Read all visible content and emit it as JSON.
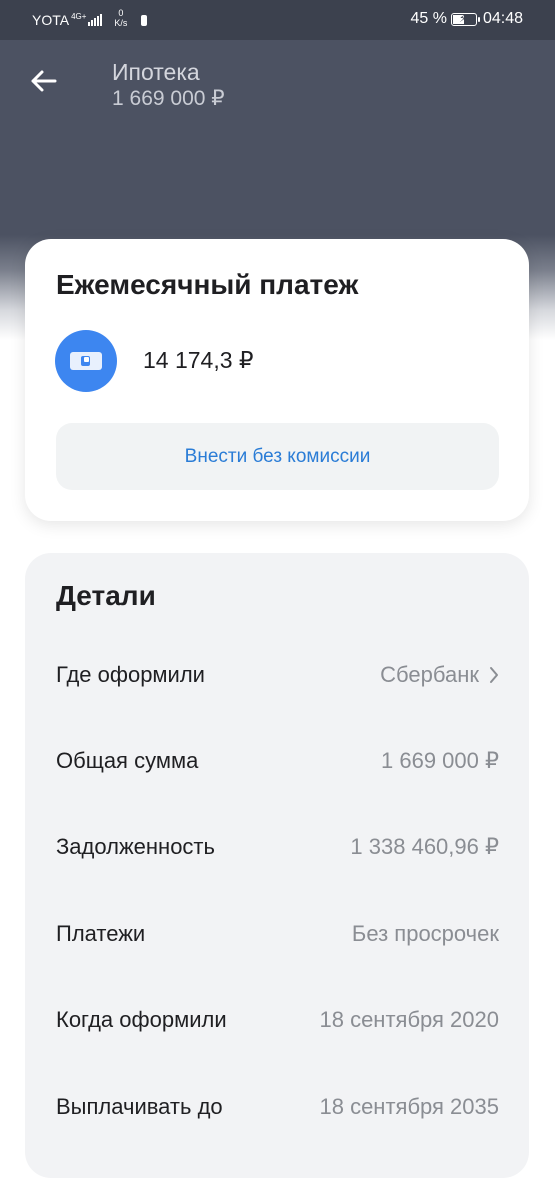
{
  "status_bar": {
    "carrier": "YOTA",
    "network": "4G+",
    "speed_value": "0",
    "speed_unit": "K/s",
    "battery_percent": "45 %",
    "time": "04:48"
  },
  "header": {
    "title": "Ипотека",
    "subtitle": "1 669 000 ₽"
  },
  "payment_card": {
    "title": "Ежемесячный платеж",
    "amount": "14 174,3 ₽",
    "button_label": "Внести без комиссии"
  },
  "details": {
    "title": "Детали",
    "rows": [
      {
        "label": "Где оформили",
        "value": "Сбербанк"
      },
      {
        "label": "Общая сумма",
        "value": "1 669 000 ₽"
      },
      {
        "label": "Задолженность",
        "value": "1 338 460,96 ₽"
      },
      {
        "label": "Платежи",
        "value": "Без просрочек"
      },
      {
        "label": "Когда оформили",
        "value": "18 сентября 2020"
      },
      {
        "label": "Выплачивать до",
        "value": "18 сентября 2035"
      }
    ]
  },
  "colors": {
    "header_bg": "#4c5262",
    "accent_blue": "#3d86f0",
    "link_blue": "#2a7cd6",
    "details_bg": "#f2f3f5"
  }
}
